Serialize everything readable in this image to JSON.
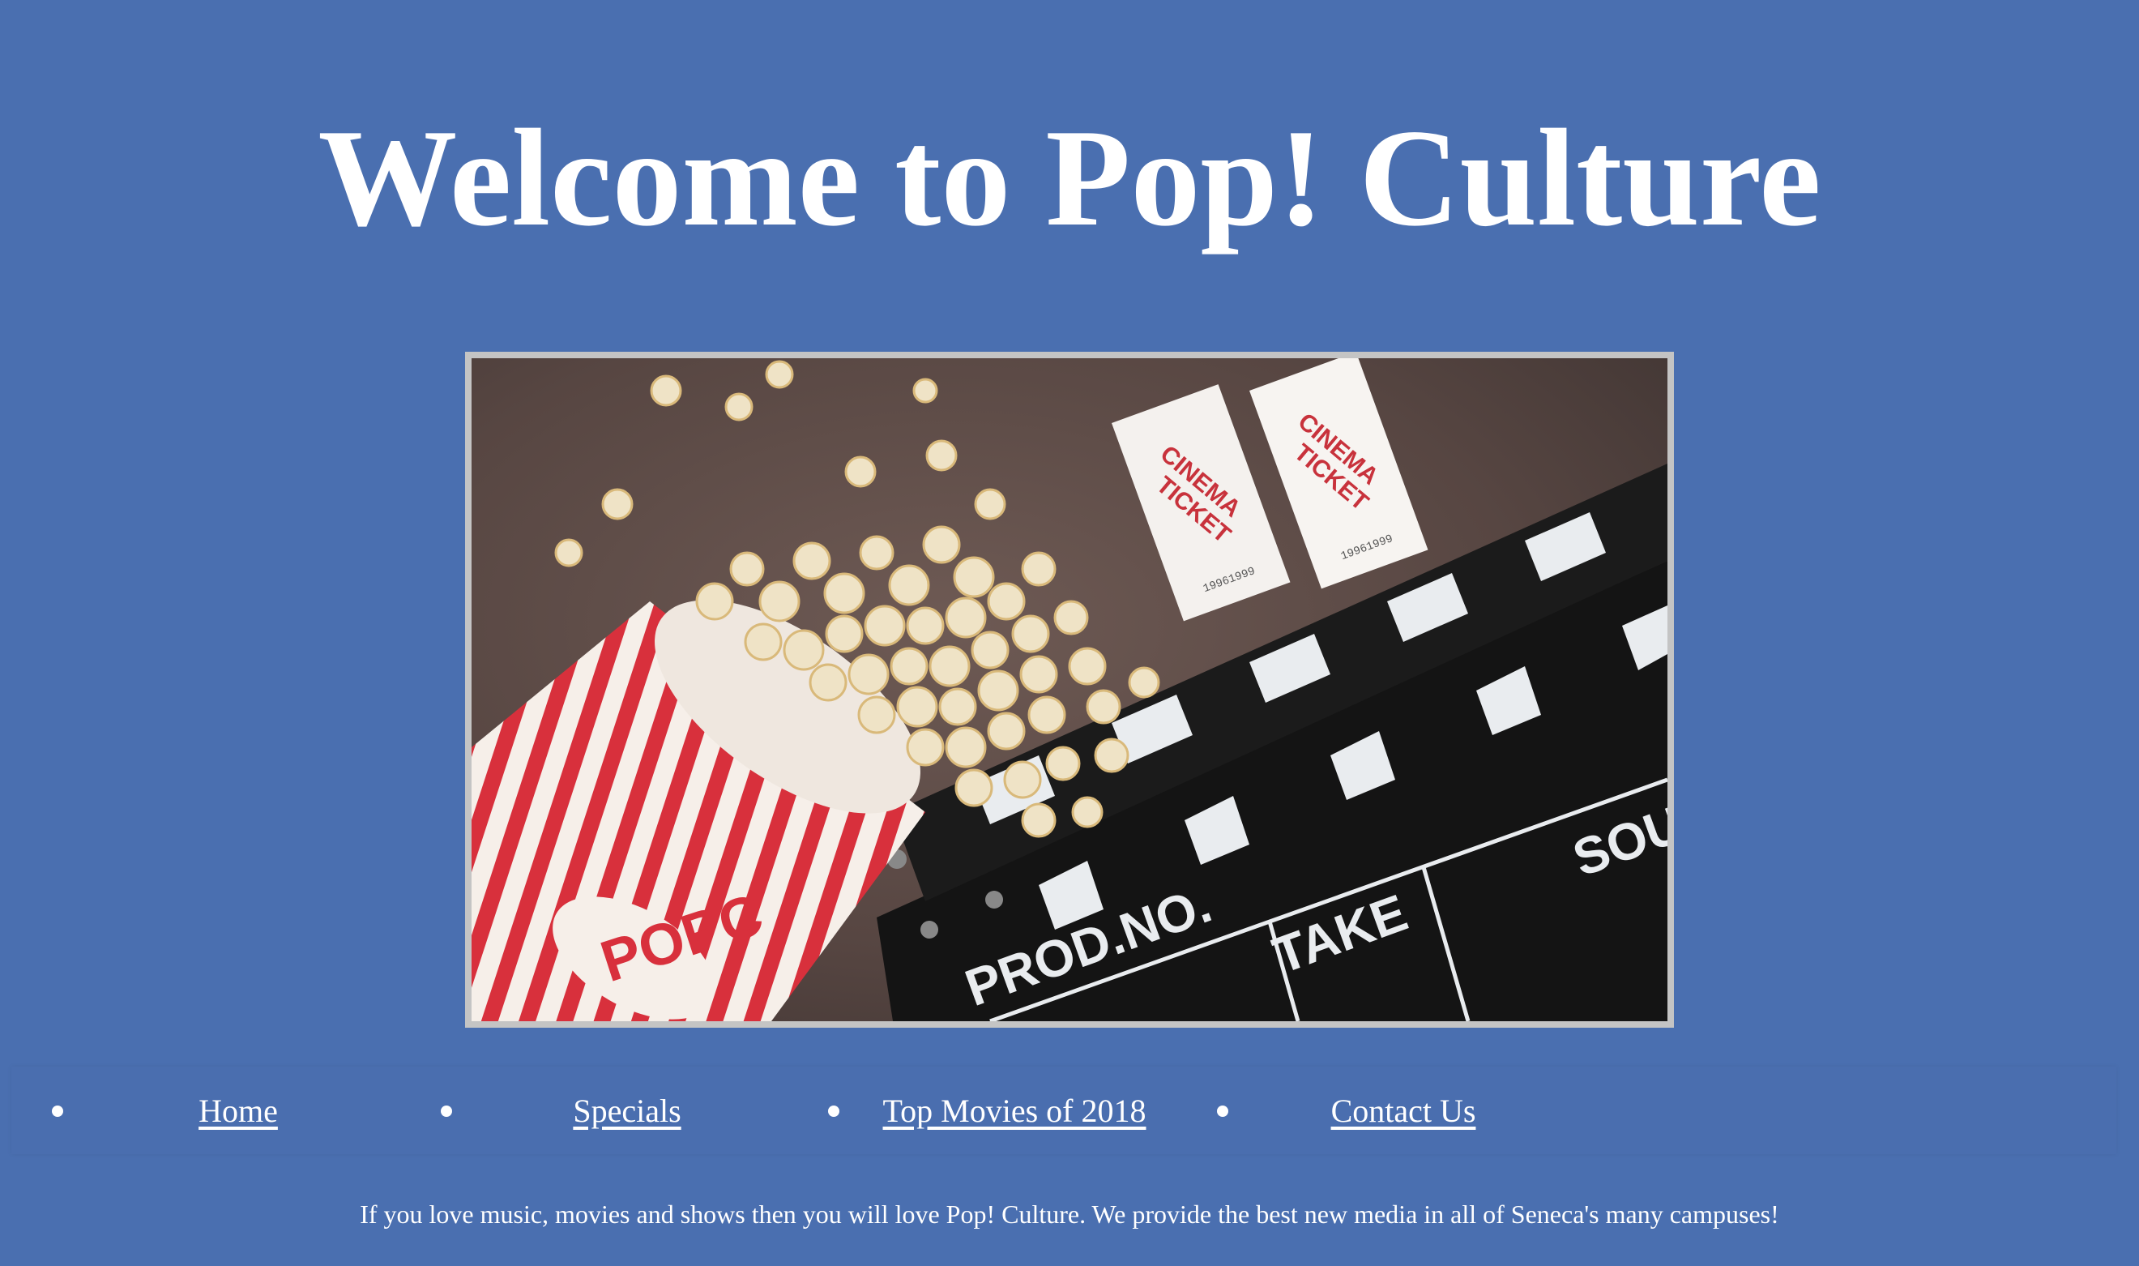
{
  "header": {
    "title": "Welcome to Pop! Culture"
  },
  "hero": {
    "image_name": "popcorn-clapperboard-cinema-tickets",
    "ticket_text_line1": "CINEMA",
    "ticket_text_line2": "TICKET",
    "ticket_serial": "19961999",
    "clapper_prod_label": "PROD.NO.",
    "clapper_take_label": "TAKE",
    "clapper_sound_label": "SOU",
    "popcorn_cup_label": "POPC"
  },
  "nav": {
    "items": [
      {
        "label": "Home"
      },
      {
        "label": "Specials"
      },
      {
        "label": "Top Movies of 2018"
      },
      {
        "label": "Contact Us"
      }
    ]
  },
  "main": {
    "intro_text": "If you love music, movies and shows then you will love Pop! Culture. We provide the best new media in all of Seneca's many campuses!"
  },
  "colors": {
    "background": "#4a6fb0",
    "text": "#ffffff",
    "image_border": "#c4c4c4"
  }
}
